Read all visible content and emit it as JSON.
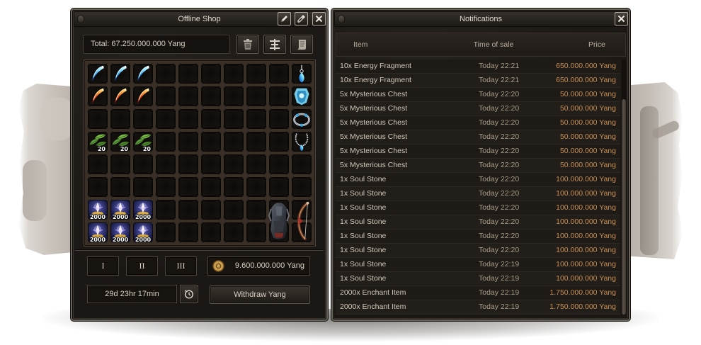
{
  "shop": {
    "title": "Offline Shop",
    "title_button_icons": [
      "pencil-icon",
      "pipette-icon",
      "close-icon"
    ],
    "total": "Total: 67.250.000.000 Yang",
    "toolbar_icons": [
      "trash-icon",
      "sort-icon",
      "scroll-icon"
    ],
    "items": [
      {
        "icon": "blue-feather-icon"
      },
      {
        "icon": "blue-feather-icon"
      },
      {
        "icon": "blue-feather-icon"
      },
      {
        "icon": "earring-icon"
      },
      {
        "icon": "red-feather-icon"
      },
      {
        "icon": "red-feather-icon"
      },
      {
        "icon": "red-feather-icon"
      },
      {
        "icon": "blue-shield-icon"
      },
      {
        "icon": "bracelet-icon"
      },
      {
        "icon": "green-leaf-icon",
        "count": "20"
      },
      {
        "icon": "green-leaf-icon",
        "count": "20"
      },
      {
        "icon": "green-leaf-icon",
        "count": "20"
      },
      {
        "icon": "necklace-icon"
      },
      {
        "icon": "enchant-item-icon",
        "count": "2000"
      },
      {
        "icon": "enchant-item-icon",
        "count": "2000"
      },
      {
        "icon": "enchant-item-icon",
        "count": "2000"
      },
      {
        "icon": "armor-icon"
      },
      {
        "icon": "bow-icon"
      },
      {
        "icon": "enchant-item-icon",
        "count": "2000"
      },
      {
        "icon": "enchant-item-icon",
        "count": "2000"
      },
      {
        "icon": "enchant-item-icon",
        "count": "2000"
      }
    ],
    "page_tabs": [
      "I",
      "II",
      "III"
    ],
    "yang_balance": "9.600.000.000 Yang",
    "remaining_time": "29d 23hr 17min",
    "withdraw_label": "Withdraw Yang",
    "coin_icon": "yang-coin-icon",
    "clock_icon": "clock-icon"
  },
  "notifications": {
    "title": "Notifications",
    "columns": [
      "Item",
      "Time of sale",
      "Price"
    ],
    "rows": [
      {
        "item": "10x Energy Fragment",
        "time": "Today 22:21",
        "price": "650.000.000 Yang"
      },
      {
        "item": "10x Energy Fragment",
        "time": "Today 22:21",
        "price": "650.000.000 Yang"
      },
      {
        "item": "5x Mysterious Chest",
        "time": "Today 22:20",
        "price": "50.000.000 Yang"
      },
      {
        "item": "5x Mysterious Chest",
        "time": "Today 22:20",
        "price": "50.000.000 Yang"
      },
      {
        "item": "5x Mysterious Chest",
        "time": "Today 22:20",
        "price": "50.000.000 Yang"
      },
      {
        "item": "5x Mysterious Chest",
        "time": "Today 22:20",
        "price": "50.000.000 Yang"
      },
      {
        "item": "5x Mysterious Chest",
        "time": "Today 22:20",
        "price": "50.000.000 Yang"
      },
      {
        "item": "5x Mysterious Chest",
        "time": "Today 22:20",
        "price": "50.000.000 Yang"
      },
      {
        "item": "1x Soul Stone",
        "time": "Today 22:20",
        "price": "100.000.000 Yang"
      },
      {
        "item": "1x Soul Stone",
        "time": "Today 22:20",
        "price": "100.000.000 Yang"
      },
      {
        "item": "1x Soul Stone",
        "time": "Today 22:20",
        "price": "100.000.000 Yang"
      },
      {
        "item": "1x Soul Stone",
        "time": "Today 22:20",
        "price": "100.000.000 Yang"
      },
      {
        "item": "1x Soul Stone",
        "time": "Today 22:20",
        "price": "100.000.000 Yang"
      },
      {
        "item": "1x Soul Stone",
        "time": "Today 22:20",
        "price": "100.000.000 Yang"
      },
      {
        "item": "1x Soul Stone",
        "time": "Today 22:19",
        "price": "100.000.000 Yang"
      },
      {
        "item": "1x Soul Stone",
        "time": "Today 22:19",
        "price": "100.000.000 Yang"
      },
      {
        "item": "2000x Enchant Item",
        "time": "Today 22:19",
        "price": "1.750.000.000 Yang"
      },
      {
        "item": "2000x Enchant Item",
        "time": "Today 22:19",
        "price": "1.750.000.000 Yang"
      }
    ],
    "close_icon": "close-icon"
  },
  "colors": {
    "window_bg": "#1d1a16",
    "window_frame": "#6a635a",
    "item_text": "#d0c8ba",
    "time_text": "#a99d89",
    "price_text": "#c98f55"
  }
}
